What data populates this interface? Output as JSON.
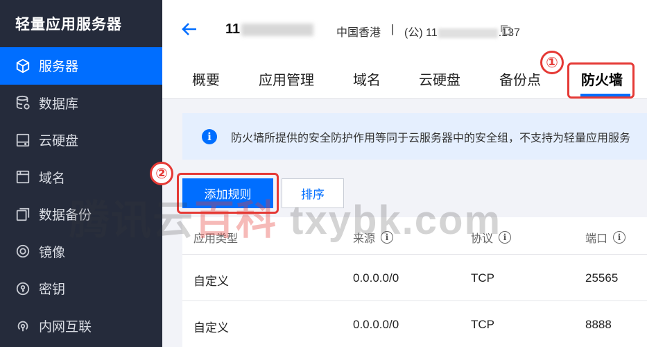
{
  "sidebar": {
    "title": "轻量应用服务器",
    "items": [
      {
        "label": "服务器",
        "icon": "cube-icon",
        "active": true
      },
      {
        "label": "数据库",
        "icon": "database-icon",
        "active": false
      },
      {
        "label": "云硬盘",
        "icon": "disk-icon",
        "active": false
      },
      {
        "label": "域名",
        "icon": "domain-icon",
        "active": false
      },
      {
        "label": "数据备份",
        "icon": "backup-icon",
        "active": false
      },
      {
        "label": "镜像",
        "icon": "image-icon",
        "active": false
      },
      {
        "label": "密钥",
        "icon": "key-icon",
        "active": false
      },
      {
        "label": "内网互联",
        "icon": "network-icon",
        "active": false
      }
    ]
  },
  "header": {
    "server_name_prefix": "11",
    "region": "中国香港",
    "separator": "|",
    "ip_prefix": "(公) 11",
    "ip_suffix": ".137"
  },
  "tabs": [
    {
      "label": "概要",
      "active": false
    },
    {
      "label": "应用管理",
      "active": false
    },
    {
      "label": "域名",
      "active": false
    },
    {
      "label": "云硬盘",
      "active": false
    },
    {
      "label": "备份点",
      "active": false
    },
    {
      "label": "防火墙",
      "active": true
    }
  ],
  "annotations": {
    "step1": "①",
    "step2": "②"
  },
  "info": {
    "text": "防火墙所提供的安全防护作用等同于云服务器中的安全组，不支持为轻量应用服务"
  },
  "actions": {
    "add_rule": "添加规则",
    "sort": "排序"
  },
  "table": {
    "headers": [
      "应用类型",
      "来源",
      "协议",
      "端口"
    ],
    "rows": [
      [
        "自定义",
        "0.0.0.0/0",
        "TCP",
        "25565"
      ],
      [
        "自定义",
        "0.0.0.0/0",
        "TCP",
        "8888"
      ]
    ]
  },
  "watermark": {
    "part1": "腾讯云",
    "part2": "百科",
    "part3": " txybk.com"
  },
  "colors": {
    "accent": "#006eff",
    "sidebar_bg": "#252b3b",
    "annotation": "#e53935",
    "info_bg": "#e5effe"
  }
}
